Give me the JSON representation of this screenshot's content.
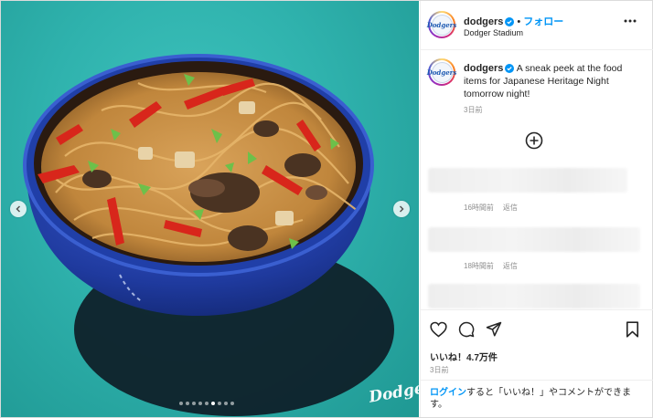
{
  "post": {
    "media": {
      "alt": "Bowl of yakisoba noodles",
      "slide_count": 9,
      "active_slide": 6,
      "watermark": "Dodgers"
    },
    "header": {
      "username": "dodgers",
      "separator": "•",
      "follow_label": "フォロー",
      "location": "Dodger Stadium",
      "avatar_text": "Dodgers"
    },
    "caption": {
      "username": "dodgers",
      "text": "A sneak peek at the food items for Japanese Heritage Night tomorrow night!",
      "time": "3日前"
    },
    "comments": [
      {
        "time": "16時間前",
        "reply_label": "返信"
      },
      {
        "time": "18時間前",
        "reply_label": "返信"
      }
    ],
    "likes_label": "いいね！4.7万件",
    "post_time": "3日前",
    "login_prompt": {
      "link": "ログイン",
      "rest": "すると「いいね！」やコメントができます。"
    }
  },
  "icons": {
    "verified": "verified-badge-icon",
    "more": "more-options-icon",
    "add_comment": "plus-circle-icon",
    "like": "heart-icon",
    "comment": "comment-bubble-icon",
    "share": "send-icon",
    "save": "bookmark-icon",
    "prev": "chevron-left-icon",
    "next": "chevron-right-icon"
  },
  "colors": {
    "link_blue": "#0095f6",
    "verified_blue": "#0095f6",
    "background_teal": "#2fb2ad",
    "bowl_blue": "#1e3fa6"
  }
}
